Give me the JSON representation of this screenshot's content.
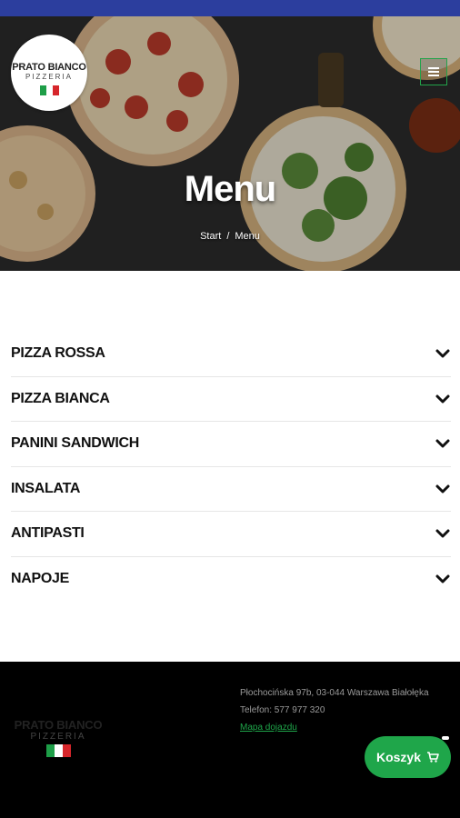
{
  "header": {
    "logo": {
      "name": "PRATO BIANCO",
      "subtitle": "PIZZERIA"
    },
    "title": "Menu",
    "breadcrumb": {
      "home": "Start",
      "separator": "/",
      "current": "Menu"
    },
    "menu_icon": "hamburger-icon"
  },
  "categories": [
    {
      "label": "PIZZA ROSSA",
      "icon": "chevron-down-icon"
    },
    {
      "label": "PIZZA BIANCA",
      "icon": "chevron-down-icon"
    },
    {
      "label": "PANINI SANDWICH",
      "icon": "chevron-down-icon"
    },
    {
      "label": "INSALATA",
      "icon": "chevron-down-icon"
    },
    {
      "label": "ANTIPASTI",
      "icon": "chevron-down-icon"
    },
    {
      "label": "NAPOJE",
      "icon": "chevron-down-icon"
    }
  ],
  "footer": {
    "logo": {
      "name": "PRATO BIANCO",
      "subtitle": "PIZZERIA"
    },
    "address": "Płochocińska 97b, 03-044 Warszawa Białołęka",
    "phone": "Telefon: 577 977 320",
    "map_link": "Mapa dojazdu"
  },
  "cart": {
    "label": "Koszyk",
    "icon": "cart-icon"
  },
  "colors": {
    "accent": "#1fa64a",
    "statusbar": "#2c3e9e",
    "footer_bg": "#000000",
    "flag_green": "#1e9e48",
    "flag_white": "#ffffff",
    "flag_red": "#d6262b"
  }
}
